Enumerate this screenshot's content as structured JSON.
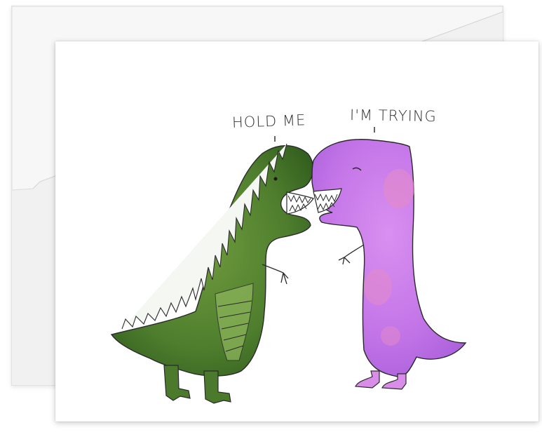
{
  "card": {
    "green_dino_caption": "HOLD ME",
    "purple_dino_caption": "I'M TRYING"
  },
  "colors": {
    "green_dino": "#4b7a2c",
    "green_dino_light": "#7fa94a",
    "purple_dino": "#c879e6",
    "purple_dino_pink": "#e58ac8",
    "envelope": "#f1f1f1",
    "card": "#ffffff",
    "line": "#2a2a2a"
  }
}
